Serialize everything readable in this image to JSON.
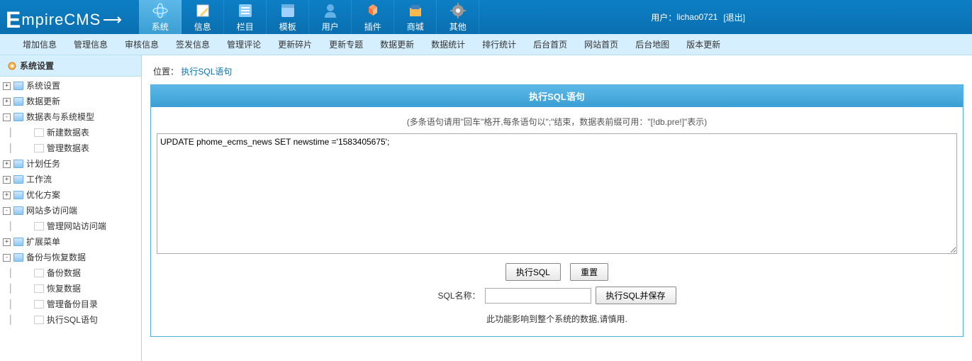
{
  "brand": "mpireCMS",
  "top_nav": [
    {
      "label": "系统",
      "icon": "globe-icon",
      "active": true
    },
    {
      "label": "信息",
      "icon": "edit-icon"
    },
    {
      "label": "栏目",
      "icon": "list-icon"
    },
    {
      "label": "模板",
      "icon": "template-icon"
    },
    {
      "label": "用户",
      "icon": "user-icon"
    },
    {
      "label": "插件",
      "icon": "plugin-icon"
    },
    {
      "label": "商城",
      "icon": "shop-icon"
    },
    {
      "label": "其他",
      "icon": "gear-icon"
    }
  ],
  "user": {
    "label": "用户：",
    "name": "lichao0721",
    "logout": "[退出]"
  },
  "sub_nav": [
    "增加信息",
    "管理信息",
    "审核信息",
    "签发信息",
    "管理评论",
    "更新碎片",
    "更新专题",
    "数据更新",
    "数据统计",
    "排行统计",
    "后台首页",
    "网站首页",
    "后台地图",
    "版本更新"
  ],
  "sidebar": {
    "title": "系统设置",
    "tree": [
      {
        "label": "系统设置",
        "type": "folder",
        "toggle": "+",
        "indent": 0
      },
      {
        "label": "数据更新",
        "type": "folder",
        "toggle": "+",
        "indent": 0
      },
      {
        "label": "数据表与系统模型",
        "type": "folder",
        "toggle": "-",
        "indent": 0
      },
      {
        "label": "新建数据表",
        "type": "file",
        "toggle": "",
        "indent": 1
      },
      {
        "label": "管理数据表",
        "type": "file",
        "toggle": "",
        "indent": 1
      },
      {
        "label": "计划任务",
        "type": "folder",
        "toggle": "+",
        "indent": 0
      },
      {
        "label": "工作流",
        "type": "folder",
        "toggle": "+",
        "indent": 0
      },
      {
        "label": "优化方案",
        "type": "folder",
        "toggle": "+",
        "indent": 0
      },
      {
        "label": "网站多访问端",
        "type": "folder",
        "toggle": "-",
        "indent": 0
      },
      {
        "label": "管理网站访问端",
        "type": "file",
        "toggle": "",
        "indent": 1
      },
      {
        "label": "扩展菜单",
        "type": "folder",
        "toggle": "+",
        "indent": 0
      },
      {
        "label": "备份与恢复数据",
        "type": "folder",
        "toggle": "-",
        "indent": 0
      },
      {
        "label": "备份数据",
        "type": "file",
        "toggle": "",
        "indent": 1
      },
      {
        "label": "恢复数据",
        "type": "file",
        "toggle": "",
        "indent": 1
      },
      {
        "label": "管理备份目录",
        "type": "file",
        "toggle": "",
        "indent": 1
      },
      {
        "label": "执行SQL语句",
        "type": "file",
        "toggle": "",
        "indent": 1
      }
    ]
  },
  "breadcrumb": {
    "label": "位置：",
    "current": "执行SQL语句"
  },
  "panel": {
    "title": "执行SQL语句",
    "hint": "(多条语句请用\"回车\"格开,每条语句以\";\"结束，数据表前缀可用：\"[!db.pre!]\"表示)",
    "sql_value": "UPDATE phome_ecms_news SET newstime ='1583405675';",
    "btn_execute": "执行SQL",
    "btn_reset": "重置",
    "sql_name_label": "SQL名称：",
    "sql_name_value": "",
    "btn_save": "执行SQL并保存",
    "footer": "此功能影响到整个系统的数据,请慎用."
  },
  "icons": {
    "globe-icon": "#4fb8ff",
    "edit-icon": "#ffcc66",
    "list-icon": "#88ccff",
    "template-icon": "#a0d0ff",
    "user-icon": "#66b0e8",
    "plugin-icon": "#ff9966",
    "shop-icon": "#ffb84d",
    "gear-icon": "#999"
  }
}
